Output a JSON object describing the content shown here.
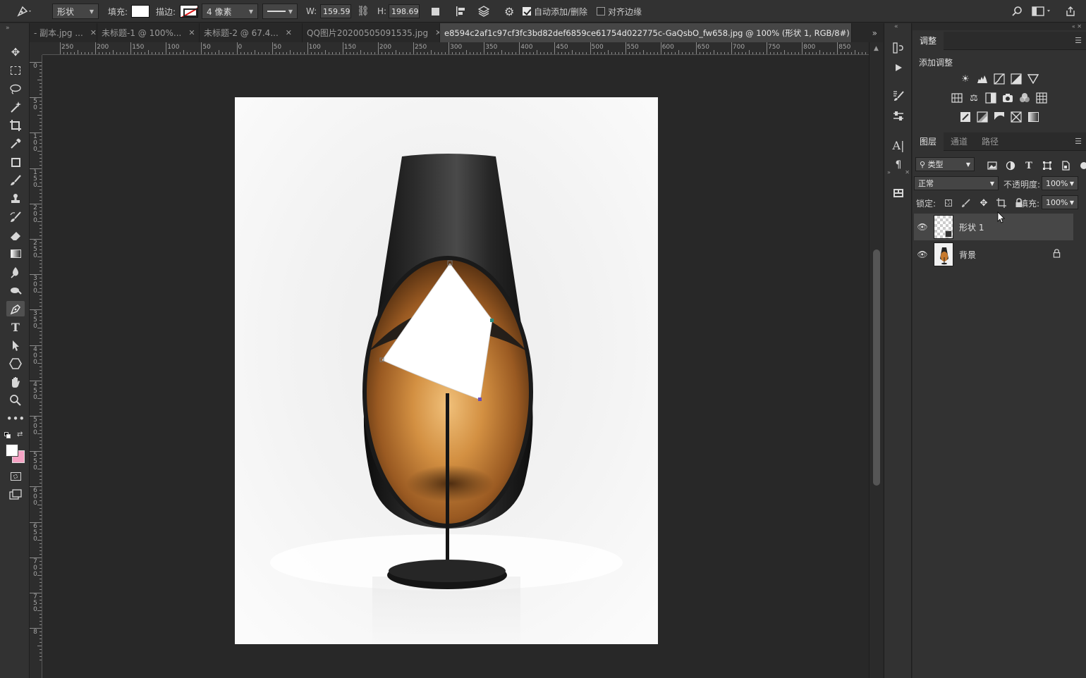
{
  "options_bar": {
    "shape_mode": "形状",
    "fill_label": "填充:",
    "stroke_label": "描边:",
    "stroke_width": "4 像素",
    "w_label": "W:",
    "w_value": "159.59",
    "h_label": "H:",
    "h_value": "198.69",
    "auto_add_delete_label": "自动添加/删除",
    "auto_add_delete_checked": true,
    "align_edges_label": "对齐边缘",
    "align_edges_checked": false
  },
  "tabs": [
    {
      "label": "- 副本.jpg ...",
      "active": false
    },
    {
      "label": "未标题-1 @ 100%...",
      "active": false
    },
    {
      "label": "未标题-2 @ 67.4...",
      "active": false
    },
    {
      "label": "QQ图片20200505091535.jpg",
      "active": false
    },
    {
      "label": "e8594c2af1c97cf3fc3bd82def6859ce61754d022775c-GaQsbO_fw658.jpg @ 100% (形状 1, RGB/8#) *",
      "active": true
    }
  ],
  "ruler_top_labels": [
    "250",
    "200",
    "150",
    "100",
    "50",
    "0",
    "50",
    "100",
    "150",
    "200",
    "250",
    "300",
    "350",
    "400",
    "450",
    "500",
    "550",
    "600",
    "650",
    "700",
    "750",
    "800",
    "850"
  ],
  "ruler_left_labels": [
    "0",
    "5 0",
    "1 0 0",
    "1 5 0",
    "2 0 0",
    "2 5 0",
    "3 0 0",
    "3 5 0",
    "4 0 0",
    "4 5 0",
    "5 0 0",
    "5 5 0",
    "6 0 0",
    "6 5 0",
    "7 0 0",
    "7 5 0",
    "8"
  ],
  "colors": {
    "foreground": "#ffffff",
    "background": "#f5a3c4",
    "lamp_outer": "#1a1a1a",
    "lamp_inner": "#c77a2e"
  },
  "adjustments_panel": {
    "tab_label": "调整",
    "add_label": "添加调整",
    "row1": [
      "brightness-icon",
      "levels-icon",
      "curves-icon",
      "exposure-icon",
      "vibrance-icon"
    ],
    "row2": [
      "hsl-icon",
      "color-balance-icon",
      "bw-icon",
      "photo-filter-icon",
      "channel-mixer-icon",
      "color-lookup-icon"
    ],
    "row3": [
      "invert-icon",
      "posterize-icon",
      "threshold-icon",
      "selective-color-icon",
      "gradient-map-icon"
    ]
  },
  "layers_panel": {
    "tabs": [
      "图层",
      "通道",
      "路径"
    ],
    "filter_label": "类型",
    "blend_mode": "正常",
    "opacity_label": "不透明度:",
    "opacity_value": "100%",
    "lock_label": "锁定:",
    "fill_label": "填充:",
    "fill_value": "100%",
    "layers": [
      {
        "name": "形状 1",
        "selected": true,
        "locked": false
      },
      {
        "name": "背景",
        "selected": false,
        "locked": true
      }
    ]
  }
}
